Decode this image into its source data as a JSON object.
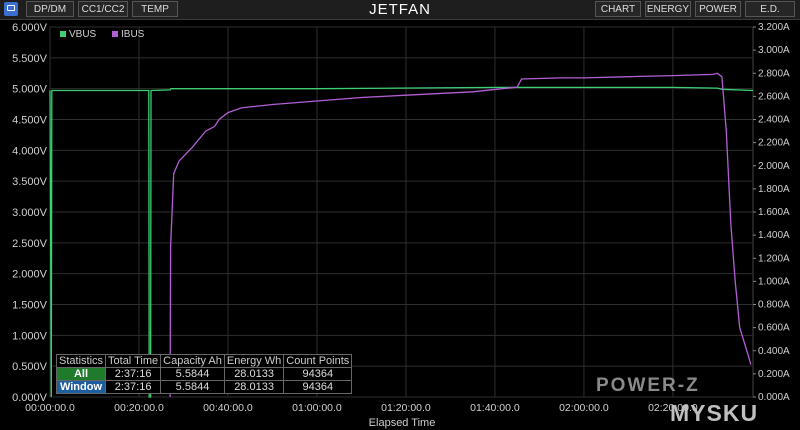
{
  "app": {
    "title": "JETFAN",
    "left_tabs": [
      "DP/DM",
      "CC1/CC2",
      "TEMP"
    ],
    "right_tabs": [
      "CHART",
      "ENERGY",
      "POWER",
      "E.D."
    ]
  },
  "chart_data": {
    "type": "line",
    "xlabel": "Elapsed Time",
    "x_ticks": [
      "00:00:00.0",
      "00:20:00.0",
      "00:40:00.0",
      "01:00:00.0",
      "01:20:00.0",
      "01:40:00.0",
      "02:00:00.0",
      "02:20:00.0"
    ],
    "y_left_ticks": [
      "0.000V",
      "0.500V",
      "1.000V",
      "1.500V",
      "2.000V",
      "2.500V",
      "3.000V",
      "3.500V",
      "4.000V",
      "4.500V",
      "5.000V",
      "5.500V",
      "6.000V"
    ],
    "y_right_ticks": [
      "0.000A",
      "0.200A",
      "0.400A",
      "0.600A",
      "0.800A",
      "1.000A",
      "1.200A",
      "1.400A",
      "1.600A",
      "1.800A",
      "2.000A",
      "2.200A",
      "2.400A",
      "2.600A",
      "2.800A",
      "3.000A",
      "3.200A"
    ],
    "y_left_range": [
      0,
      6.0
    ],
    "y_right_range": [
      0,
      3.2
    ],
    "x_range_minutes": [
      0,
      158
    ],
    "grid": true,
    "legend_position": "top-left",
    "series": [
      {
        "name": "VBUS",
        "unit": "V",
        "axis": "left",
        "color": "#3ccf73",
        "points": [
          [
            0,
            4.97
          ],
          [
            0.3,
            0
          ],
          [
            0.4,
            4.97
          ],
          [
            22.2,
            4.97
          ],
          [
            22.3,
            0
          ],
          [
            22.6,
            0
          ],
          [
            22.7,
            4.97
          ],
          [
            27,
            4.98
          ],
          [
            27.2,
            5.0
          ],
          [
            60,
            5.0
          ],
          [
            100,
            5.02
          ],
          [
            140,
            5.02
          ],
          [
            150,
            5.01
          ],
          [
            151,
            4.99
          ],
          [
            158,
            4.97
          ]
        ]
      },
      {
        "name": "IBUS",
        "unit": "A",
        "axis": "right",
        "color": "#b25fd6",
        "points": [
          [
            27,
            0
          ],
          [
            27.1,
            1.3
          ],
          [
            27.8,
            1.93
          ],
          [
            29,
            2.04
          ],
          [
            32,
            2.16
          ],
          [
            35,
            2.3
          ],
          [
            37,
            2.34
          ],
          [
            38,
            2.4
          ],
          [
            40,
            2.46
          ],
          [
            43,
            2.5
          ],
          [
            50,
            2.53
          ],
          [
            60,
            2.56
          ],
          [
            70,
            2.59
          ],
          [
            80,
            2.61
          ],
          [
            95,
            2.64
          ],
          [
            105,
            2.68
          ],
          [
            106,
            2.75
          ],
          [
            115,
            2.76
          ],
          [
            120,
            2.76
          ],
          [
            130,
            2.77
          ],
          [
            140,
            2.78
          ],
          [
            149,
            2.79
          ],
          [
            150,
            2.8
          ],
          [
            151,
            2.77
          ],
          [
            152,
            2.3
          ],
          [
            153,
            1.5
          ],
          [
            154,
            1.0
          ],
          [
            155,
            0.6
          ],
          [
            157,
            0.35
          ],
          [
            157.5,
            0.28
          ]
        ]
      }
    ],
    "legend": [
      "VBUS",
      "IBUS"
    ]
  },
  "stats": {
    "headers": [
      "Statistics",
      "Total Time",
      "Capacity Ah",
      "Energy Wh",
      "Count Points"
    ],
    "rows": [
      [
        "All",
        "2:37:16",
        "5.5844",
        "28.0133",
        "94364"
      ],
      [
        "Window",
        "2:37:16",
        "5.5844",
        "28.0133",
        "94364"
      ]
    ]
  },
  "watermarks": {
    "power": "POWER-Z",
    "site": "MYSKU"
  }
}
